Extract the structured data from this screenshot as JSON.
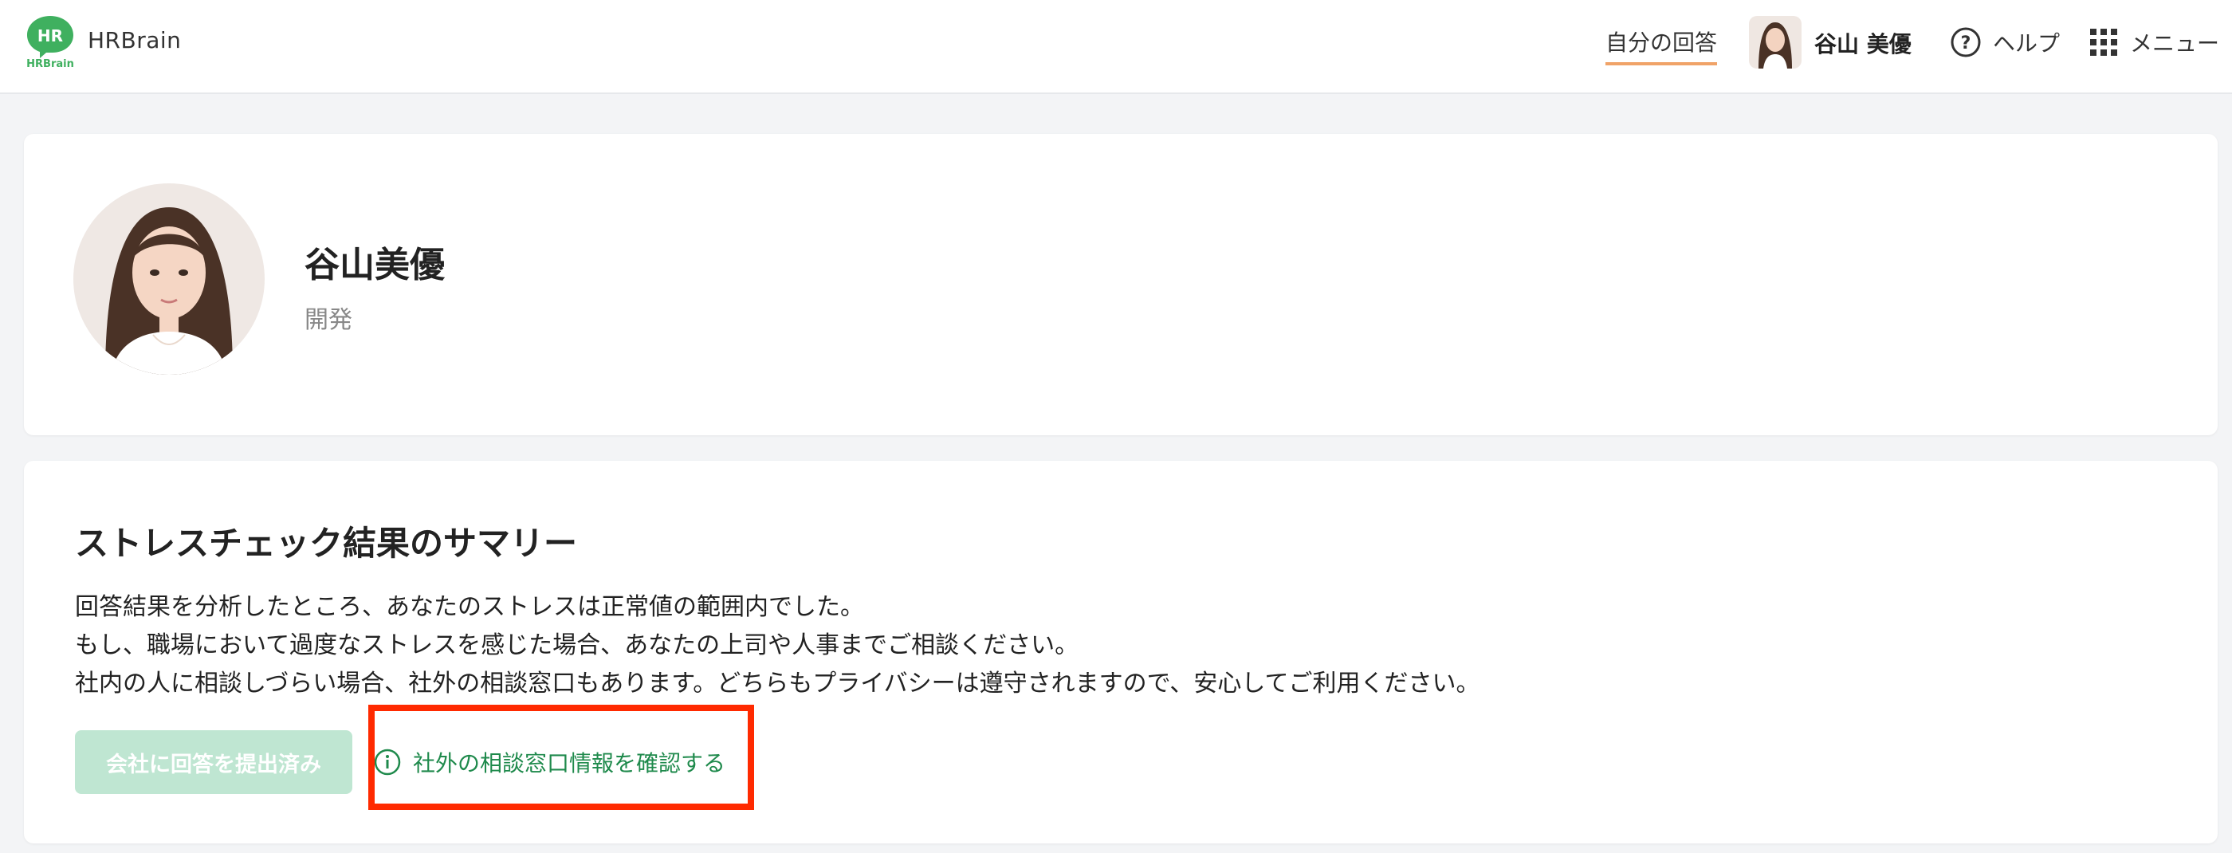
{
  "header": {
    "logo_text": "HR",
    "logo_sub": "HRBrain",
    "brand": "HRBrain",
    "nav_my_answers": "自分の回答",
    "user_name": "谷山 美優",
    "help_label": "ヘルプ",
    "menu_label": "メニュー"
  },
  "profile": {
    "name": "谷山美優",
    "department": "開発"
  },
  "summary": {
    "title": "ストレスチェック結果のサマリー",
    "lines": [
      "回答結果を分析したところ、あなたのストレスは正常値の範囲内でした。",
      "もし、職場において過度なストレスを感じた場合、あなたの上司や人事までご相談ください。",
      "社内の人に相談しづらい場合、社外の相談窓口もあります。どちらもプライバシーは遵守されますので、安心してご利用ください。"
    ],
    "submitted_button": "会社に回答を提出済み",
    "consult_link": "社外の相談窓口情報を確認する"
  },
  "colors": {
    "accent_green": "#1f8a4c",
    "logo_green": "#3fb05f",
    "submitted_bg": "#bfe6d2",
    "nav_underline": "#f0a368",
    "highlight": "#ff2a00"
  },
  "icons": {
    "help": "question-circle-icon",
    "menu": "grid-icon",
    "info": "info-circle-icon"
  }
}
